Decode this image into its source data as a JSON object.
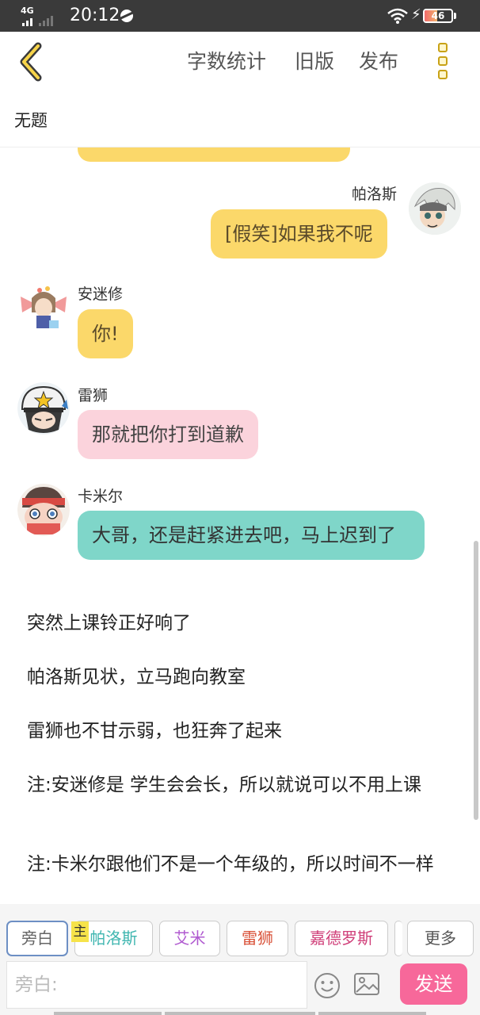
{
  "status_bar": {
    "network": "4G",
    "time": "20:12",
    "battery": "46",
    "battery_level": 0.46
  },
  "toolbar": {
    "word_count_label": "字数统计",
    "old_version_label": "旧版",
    "publish_label": "发布",
    "icons": {
      "back": "chevron-left-icon",
      "more": "more-vertical-icon"
    }
  },
  "document": {
    "title": "无题"
  },
  "chat": {
    "messages": [
      {
        "speaker": "帕洛斯",
        "text": "[假笑]如果我不呢",
        "side": "right",
        "color": "#fbd86a"
      },
      {
        "speaker": "安迷修",
        "text": "你!",
        "side": "left",
        "color": "#fbd86a"
      },
      {
        "speaker": "雷狮",
        "text": "那就把你打到道歉",
        "side": "left",
        "color": "#fbd3dc"
      },
      {
        "speaker": "卡米尔",
        "text": "大哥，还是赶紧进去吧，马上迟到了",
        "side": "left",
        "color": "#7fd6c9"
      }
    ],
    "narration": [
      "突然上课铃正好响了",
      "帕洛斯见状，立马跑向教室",
      "雷狮也不甘示弱，也狂奔了起来",
      "注:安迷修是 学生会会长，所以就说可以不用上课",
      "注:卡米尔跟他们不是一个年级的，所以时间不一样"
    ]
  },
  "characters": {
    "host_badge": "主",
    "items": [
      {
        "label": "旁白",
        "color": "#666666"
      },
      {
        "label": "帕洛斯",
        "color": "#3fb6b0"
      },
      {
        "label": "艾米",
        "color": "#b05ad0"
      },
      {
        "label": "雷狮",
        "color": "#d9533a"
      },
      {
        "label": "嘉德罗斯",
        "color": "#d0407a"
      }
    ],
    "more_label": "更多"
  },
  "composer": {
    "placeholder": "旁白:",
    "send_label": "发送",
    "icons": {
      "emoji": "smiley-icon",
      "image": "image-icon"
    }
  }
}
